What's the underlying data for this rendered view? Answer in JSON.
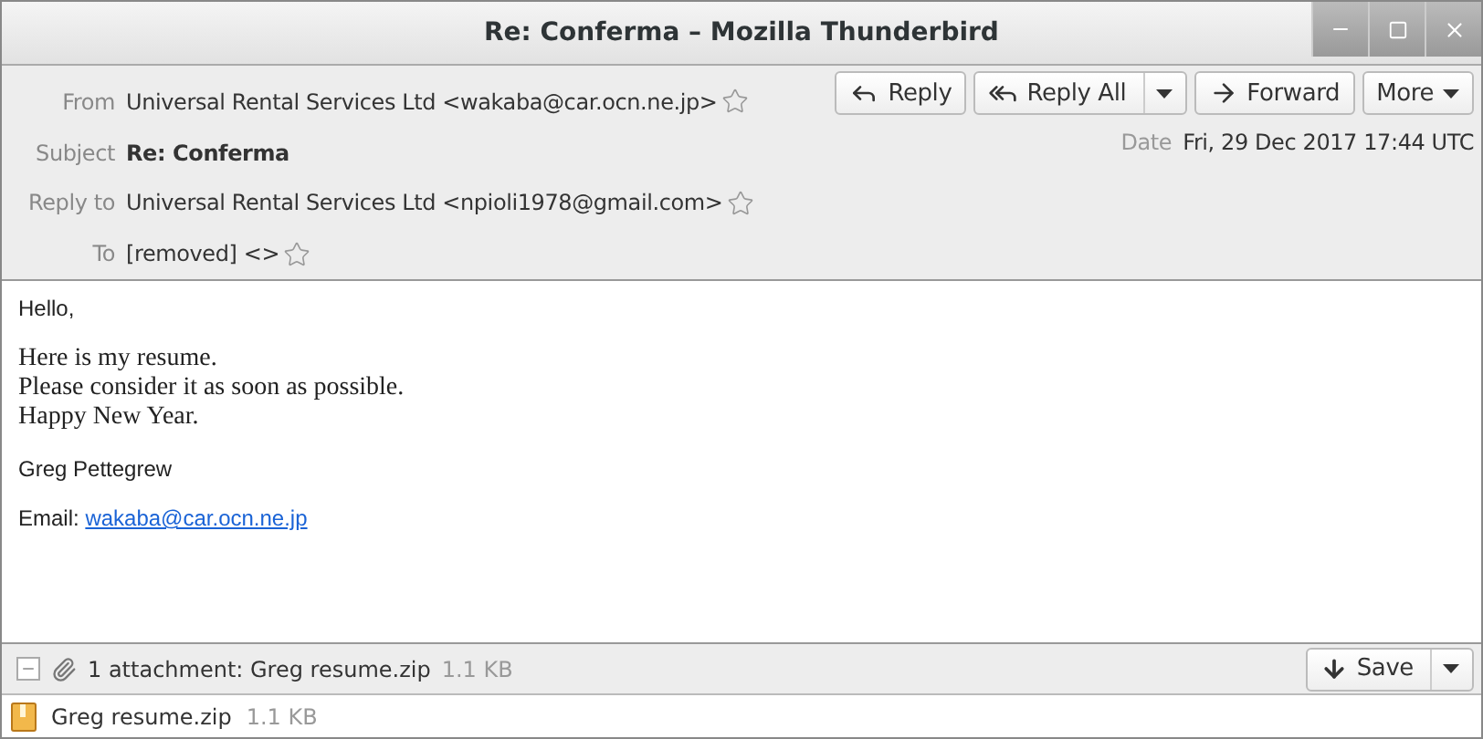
{
  "window": {
    "title": "Re: Conferma – Mozilla Thunderbird"
  },
  "header": {
    "fields": [
      {
        "kind": "address",
        "label": "From",
        "value": "Universal Rental Services Ltd <wakaba@car.ocn.ne.jp>"
      },
      {
        "kind": "subject",
        "label": "Subject",
        "value": "Re: Conferma"
      },
      {
        "kind": "address",
        "label": "Reply to",
        "value": "Universal Rental Services Ltd <npioli1978@gmail.com>"
      },
      {
        "kind": "address",
        "label": "To",
        "value": "[removed] <>"
      }
    ],
    "date": {
      "label": "Date",
      "value": "Fri, 29 Dec 2017 17:44 UTC"
    },
    "buttons": [
      {
        "kind": "reply",
        "label": "Reply"
      },
      {
        "kind": "reply-all",
        "label": "Reply All"
      },
      {
        "kind": "forward",
        "label": "Forward"
      },
      {
        "kind": "more",
        "label": "More"
      }
    ]
  },
  "body": [
    {
      "kind": "sans",
      "lines": [
        "Hello,"
      ]
    },
    {
      "kind": "serif",
      "lines": [
        "Here is my resume.",
        "Please consider it as soon as possible.",
        "Happy New Year."
      ]
    },
    {
      "kind": "sans",
      "lines": [
        "Greg Pettegrew"
      ]
    },
    {
      "kind": "email",
      "label": "Email:",
      "link": "wakaba@car.ocn.ne.jp"
    }
  ],
  "attachments": {
    "summary": "1 attachment: Greg resume.zip",
    "size": "1.1 KB",
    "save": "Save",
    "items": [
      {
        "name": "Greg resume.zip",
        "size": "1.1 KB"
      }
    ]
  }
}
